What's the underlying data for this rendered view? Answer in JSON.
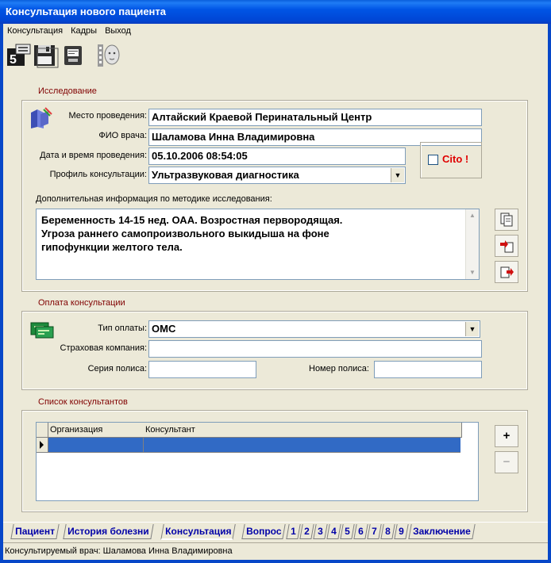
{
  "window": {
    "title": "Консультация нового пациента"
  },
  "menu": [
    "Консультация",
    "Кадры",
    "Выход"
  ],
  "toolbar": {
    "icons": [
      "patient-number-icon",
      "save-icon",
      "print-preview-icon",
      "photo-face-icon"
    ],
    "patient_number_badge": "5"
  },
  "study": {
    "group_title": "Исследование",
    "place_label": "Место проведения:",
    "place_value": "Алтайский Краевой Перинатальный Центр",
    "doctor_label": "ФИО врача:",
    "doctor_value": "Шаламова Инна Владимировна",
    "datetime_label": "Дата и время проведения:",
    "datetime_value": "05.10.2006 08:54:05",
    "profile_label": "Профиль консультации:",
    "profile_value": "Ультразвуковая диагностика",
    "cito_label": "Cito !",
    "cito_checked": false,
    "additional_label": "Дополнительная информация по методике исследования:",
    "additional_lines": [
      "Беременность 14-15 нед. ОАА. Возростная первородящая.",
      "Угроза раннего самопроизвольного выкидыша на фоне",
      "гипофункции желтого тела."
    ]
  },
  "payment": {
    "group_title": "Оплата консультации",
    "type_label": "Тип оплаты:",
    "type_value": "ОМС",
    "insurer_label": "Страховая компания:",
    "insurer_value": "",
    "series_label": "Серия полиса:",
    "series_value": "",
    "number_label": "Номер полиса:",
    "number_value": ""
  },
  "consultants": {
    "group_title": "Список консультантов",
    "columns": [
      "Организация",
      "Консультант"
    ],
    "add_label": "+",
    "remove_label": "−"
  },
  "tabs": [
    "Пациент",
    "История болезни",
    "Консультация",
    "Вопрос",
    "1",
    "2",
    "3",
    "4",
    "5",
    "6",
    "7",
    "8",
    "9",
    "Заключение"
  ],
  "active_tab": "Консультация",
  "status": "Консультируемый врач: Шаламова Инна Владимировна",
  "colors": {
    "titlebar": "#0055e5",
    "group_title": "#800000",
    "tab_text": "#0000a8",
    "selection": "#316ac5",
    "cito": "#e00000"
  }
}
